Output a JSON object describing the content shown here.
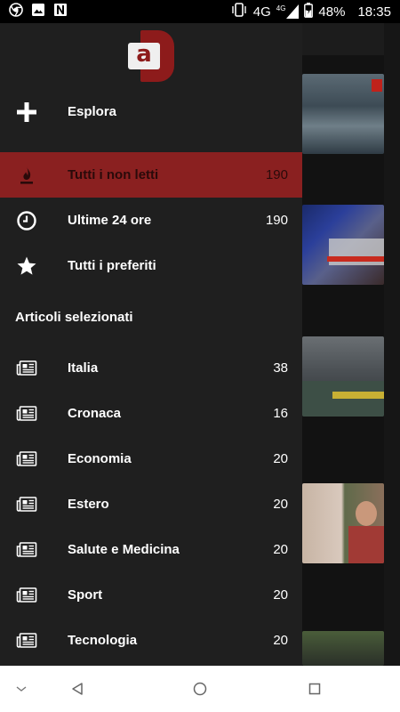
{
  "statusbar": {
    "battery": "48%",
    "time": "18:35",
    "network": "4G",
    "network_small": "4G"
  },
  "drawer": {
    "logo_letter": "a",
    "explore_label": "Esplora",
    "smart": [
      {
        "label": "Tutti i non letti",
        "count": "190",
        "icon": "flame-icon",
        "active": true
      },
      {
        "label": "Ultime 24 ore",
        "count": "190",
        "icon": "clock-icon",
        "active": false
      },
      {
        "label": "Tutti i preferiti",
        "count": "",
        "icon": "star-icon",
        "active": false
      }
    ],
    "section_title": "Articoli selezionati",
    "categories": [
      {
        "label": "Italia",
        "count": "38",
        "icon": "newspaper-icon"
      },
      {
        "label": "Cronaca",
        "count": "16",
        "icon": "newspaper-icon"
      },
      {
        "label": "Economia",
        "count": "20",
        "icon": "newspaper-icon"
      },
      {
        "label": "Estero",
        "count": "20",
        "icon": "newspaper-icon"
      },
      {
        "label": "Salute e Medicina",
        "count": "20",
        "icon": "newspaper-icon"
      },
      {
        "label": "Sport",
        "count": "20",
        "icon": "newspaper-icon"
      },
      {
        "label": "Tecnologia",
        "count": "20",
        "icon": "newspaper-icon"
      }
    ]
  },
  "colors": {
    "accent": "#8a2020",
    "drawer_bg": "#1f1f1f",
    "text": "#ffffff"
  }
}
